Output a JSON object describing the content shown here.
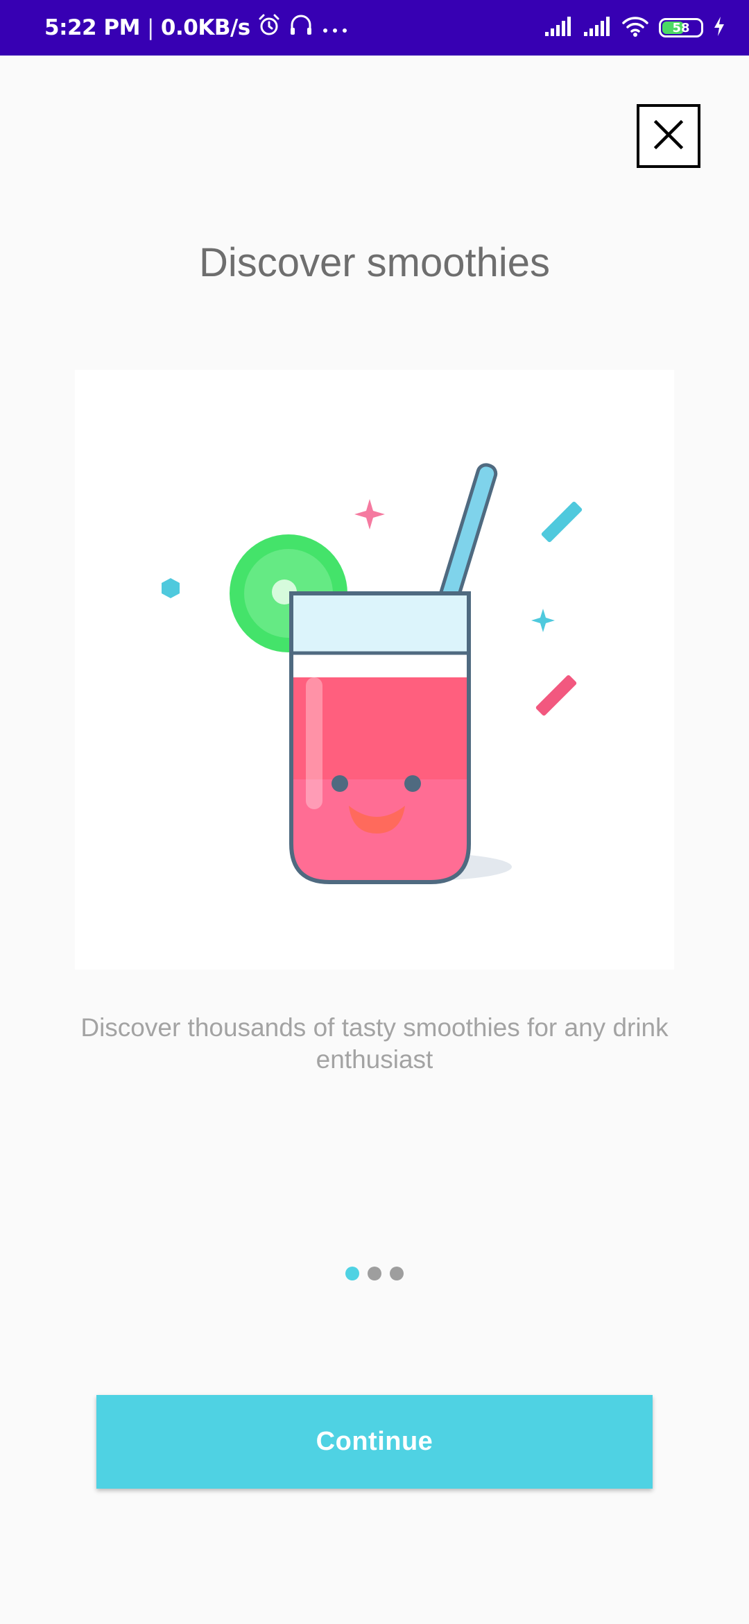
{
  "status_bar": {
    "time": "5:22 PM",
    "separator": "|",
    "network_speed": "0.0KB/s",
    "battery_level": "58",
    "battery_fraction": 0.58,
    "icons": [
      "alarm-icon",
      "headset-icon",
      "more-dots-icon",
      "signal-icon",
      "signal-icon",
      "wifi-icon",
      "battery-icon",
      "charging-icon"
    ],
    "background_color": "#3700b3"
  },
  "onboarding": {
    "title": "Discover smoothies",
    "description": "Discover thousands of tasty smoothies for any drink enthusiast",
    "illustration": "smoothie-glass-illustration",
    "close_icon": "close-icon",
    "pages_total": 3,
    "current_page": 1,
    "continue_label": "Continue"
  },
  "colors": {
    "accent": "#4fd2e3",
    "title_text": "#6e6e6e",
    "description_text": "#a3a3a3",
    "smoothie_pink": "#ff5f7e",
    "lime_green": "#44e36a"
  }
}
